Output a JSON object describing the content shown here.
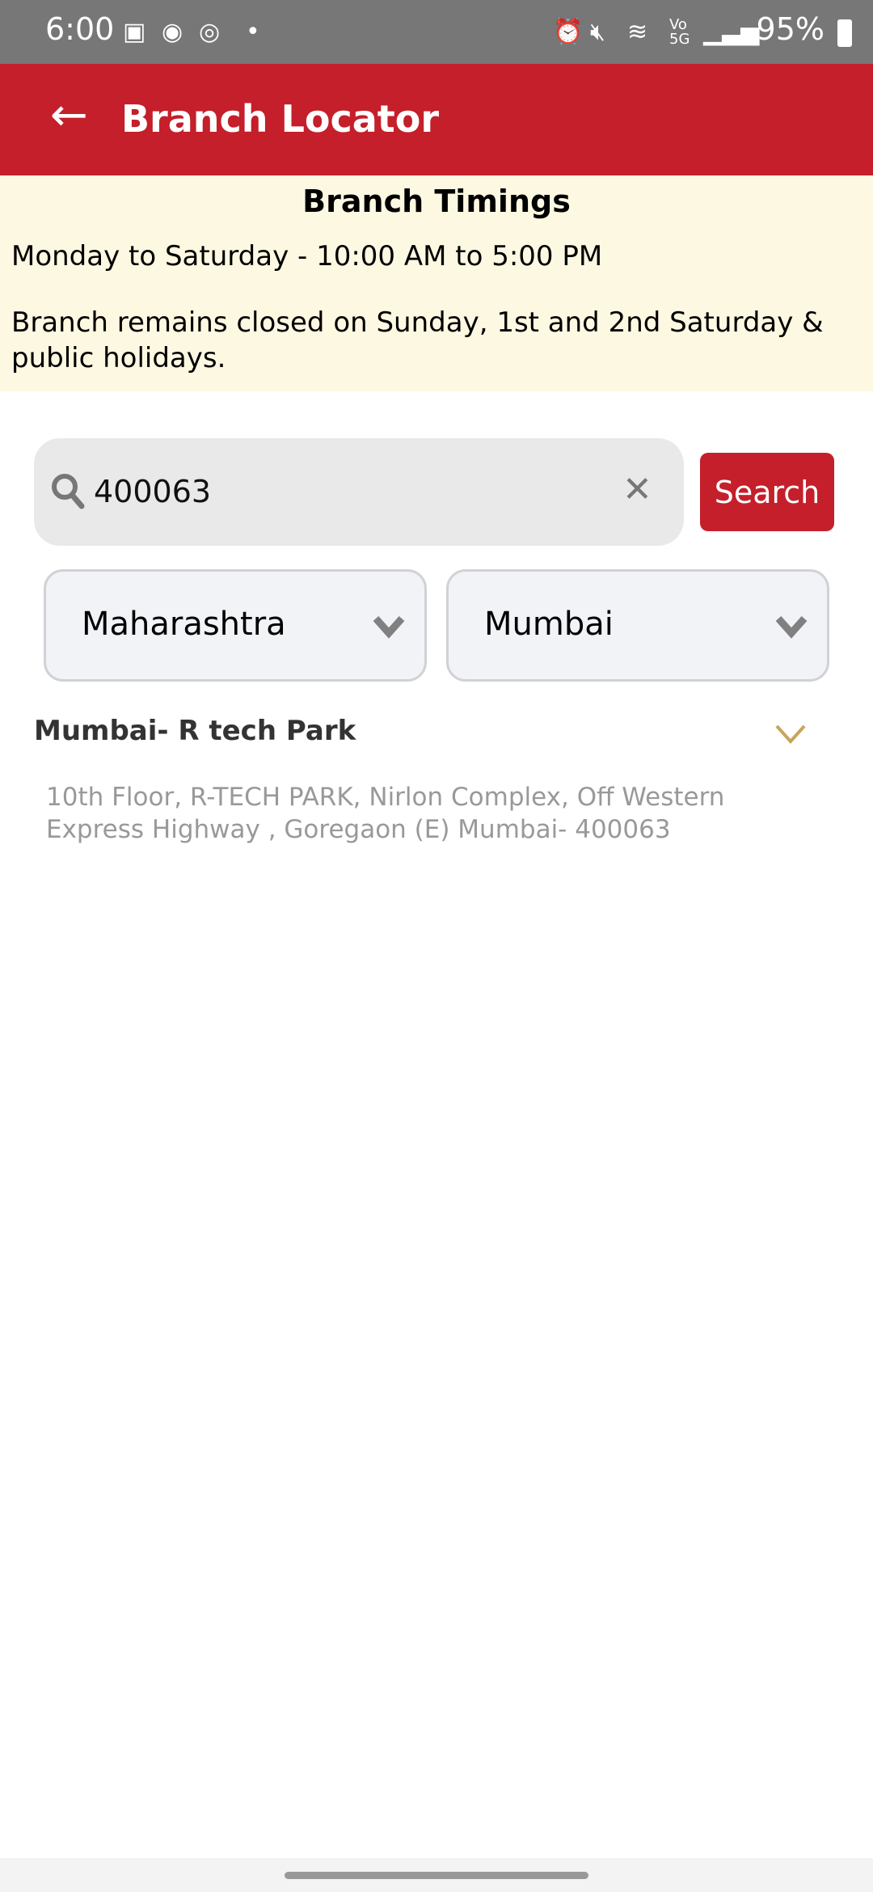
{
  "status_bar": {
    "time": "6:00",
    "battery": "95%",
    "icons": [
      "gallery-icon",
      "phone-icon",
      "whatsapp-icon",
      "dot-icon",
      "alarm-icon",
      "mute-icon",
      "wifi-icon",
      "volte-5g-icon",
      "signal-icon",
      "battery-icon"
    ]
  },
  "header": {
    "title": "Branch Locator",
    "back_icon": "arrow-left-icon"
  },
  "timings": {
    "title": "Branch Timings",
    "hours": "Monday to Saturday - 10:00 AM to 5:00 PM",
    "closed": "Branch remains closed on Sunday, 1st and 2nd Saturday & public holidays."
  },
  "search": {
    "value": "400063",
    "button_label": "Search"
  },
  "filters": {
    "state": "Maharashtra",
    "city": "Mumbai"
  },
  "results": [
    {
      "name": "Mumbai- R tech Park",
      "address": "10th Floor, R-TECH PARK, Nirlon Complex, Off Western Express Highway , Goregaon (E) Mumbai- 400063"
    }
  ],
  "colors": {
    "brand": "#C41F2A",
    "banner": "#FDF8E1",
    "accent_chevron": "#C9A45C"
  }
}
